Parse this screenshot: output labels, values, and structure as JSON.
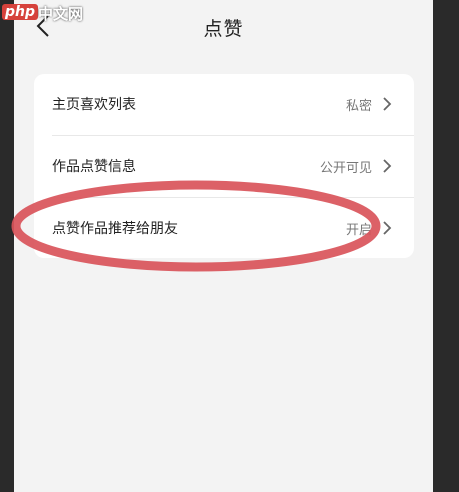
{
  "watermark": {
    "site": "php",
    "suffix": "中文网"
  },
  "header": {
    "title": "点赞",
    "back_icon": "chevron-left-icon"
  },
  "settings": [
    {
      "label": "主页喜欢列表",
      "value": "私密"
    },
    {
      "label": "作品点赞信息",
      "value": "公开可见"
    },
    {
      "label": "点赞作品推荐给朋友",
      "value": "开启"
    }
  ],
  "colors": {
    "highlight_ellipse": "#d9545a",
    "background": "#f3f3f3",
    "card": "#ffffff"
  }
}
